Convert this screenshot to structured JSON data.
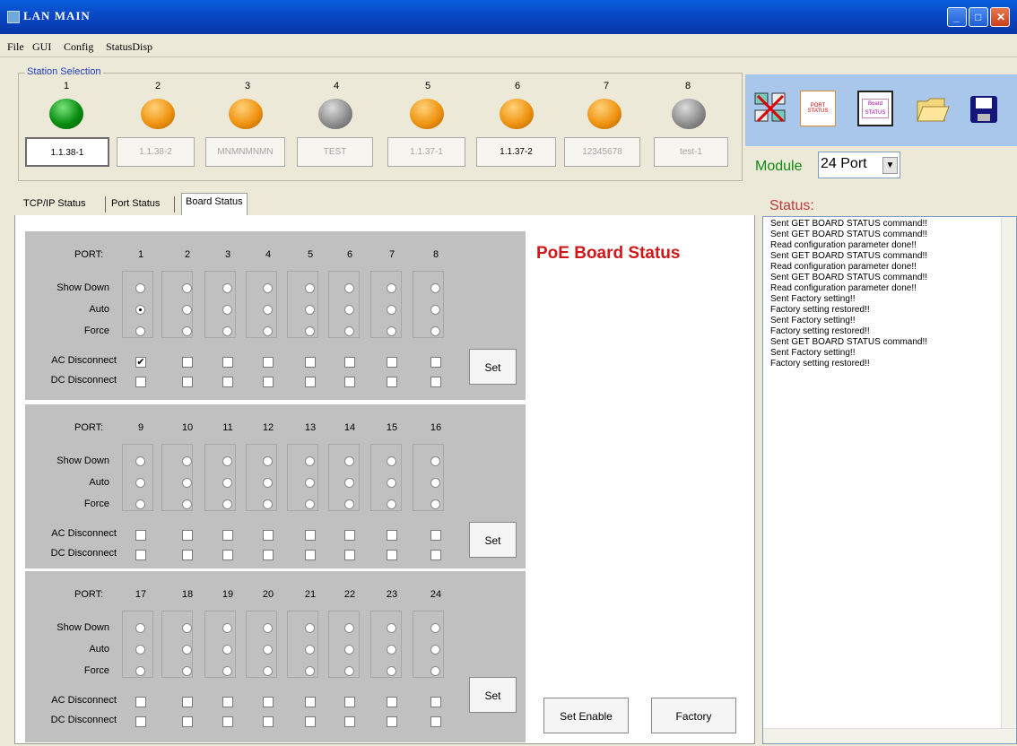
{
  "window": {
    "title": "LAN MAIN"
  },
  "menu": [
    "File",
    "GUI",
    "Config",
    "StatusDisp"
  ],
  "station_selection": {
    "label": "Station Selection",
    "stations": [
      {
        "num": "1",
        "led": "green",
        "name": "1.1.38-1",
        "state": "selected"
      },
      {
        "num": "2",
        "led": "orange",
        "name": "1.1.38-2",
        "state": "disabled"
      },
      {
        "num": "3",
        "led": "orange",
        "name": "MNMNMNMN",
        "state": "disabled"
      },
      {
        "num": "4",
        "led": "gray",
        "name": "TEST",
        "state": "disabled"
      },
      {
        "num": "5",
        "led": "orange",
        "name": "1.1.37-1",
        "state": "disabled"
      },
      {
        "num": "6",
        "led": "orange",
        "name": "1.1.37-2",
        "state": "normal"
      },
      {
        "num": "7",
        "led": "orange",
        "name": "12345678",
        "state": "disabled"
      },
      {
        "num": "8",
        "led": "gray",
        "name": "test-1",
        "state": "disabled"
      }
    ]
  },
  "toolbar": {
    "icons": [
      "network-config-icon",
      "port-status-icon",
      "board-status-icon",
      "open-folder-icon",
      "save-disk-icon"
    ],
    "port_status_text": "PORT STATUS",
    "board_status_text": "Board STATUS"
  },
  "module": {
    "label": "Module",
    "value": "24 Port"
  },
  "tabs": [
    {
      "label": "TCP/IP Status",
      "selected": false
    },
    {
      "label": "Port Status",
      "selected": false
    },
    {
      "label": "Board Status",
      "selected": true
    }
  ],
  "board": {
    "title": "PoE Board Status",
    "port_label": "PORT:",
    "modes": [
      "Show Down",
      "Auto",
      "Force"
    ],
    "ac_label": "AC Disconnect",
    "dc_label": "DC Disconnect",
    "set_label": "Set",
    "sections": [
      {
        "ports": [
          "1",
          "2",
          "3",
          "4",
          "5",
          "6",
          "7",
          "8"
        ],
        "auto_checked_port": "1",
        "ac_checked_port": "1"
      },
      {
        "ports": [
          "9",
          "10",
          "11",
          "12",
          "13",
          "14",
          "15",
          "16"
        ],
        "auto_checked_port": "",
        "ac_checked_port": ""
      },
      {
        "ports": [
          "17",
          "18",
          "19",
          "20",
          "21",
          "22",
          "23",
          "24"
        ],
        "auto_checked_port": "",
        "ac_checked_port": ""
      }
    ],
    "set_enable_label": "Set Enable",
    "factory_label": "Factory"
  },
  "status": {
    "label": "Status:",
    "lines": [
      "Sent GET BOARD STATUS command!!",
      "Sent GET BOARD STATUS command!!",
      "Read configuration parameter done!!",
      "Sent GET BOARD STATUS command!!",
      "Read configuration parameter done!!",
      "Sent GET BOARD STATUS command!!",
      "Read configuration parameter done!!",
      "Sent Factory setting!!",
      "Factory setting restored!!",
      "Sent Factory setting!!",
      "Factory setting restored!!",
      "Sent GET BOARD STATUS command!!",
      "Sent Factory setting!!",
      "Factory setting restored!!"
    ]
  }
}
